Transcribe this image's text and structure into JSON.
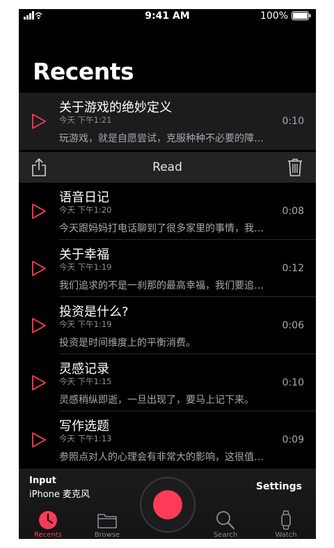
{
  "status_bar": {
    "time": "9:41 AM",
    "battery": "100%"
  },
  "title": "Recents",
  "recordings": [
    {
      "title": "关于游戏的绝妙定义",
      "date": "今天 下午1:21",
      "snippet": "玩游戏，就是自愿尝试，克服种种不必要的障…",
      "duration": "0:10"
    },
    {
      "title": "语音日记",
      "date": "今天 下午1:20",
      "snippet": "今天跟妈妈打电话聊到了很多家里的事情，我…",
      "duration": "0:08"
    },
    {
      "title": "关于幸福",
      "date": "今天 下午1:19",
      "snippet": "我们追求的不是一刹那的最高幸福，我们要追…",
      "duration": "0:12"
    },
    {
      "title": "投资是什么?",
      "date": "今天 下午1:19",
      "snippet": "投资是时间维度上的平衡消费。",
      "duration": "0:06"
    },
    {
      "title": "灵感记录",
      "date": "今天 下午1:15",
      "snippet": "灵感稍纵即逝，一旦出现了，要马上记下来。",
      "duration": "0:10"
    },
    {
      "title": "写作选题",
      "date": "今天 下午1:13",
      "snippet": "参照点对人的心理会有非常大的影响，这很值…",
      "duration": "0:09"
    }
  ],
  "action_row": {
    "read_label": "Read"
  },
  "bottom": {
    "input_label": "Input",
    "input_value": "iPhone 麦克风",
    "settings_label": "Settings",
    "tabs": [
      {
        "label": "Recents",
        "icon": "clock-icon"
      },
      {
        "label": "Browse",
        "icon": "folder-icon"
      },
      {
        "label": "Search",
        "icon": "search-icon"
      },
      {
        "label": "Watch",
        "icon": "watch-icon"
      }
    ]
  },
  "colors": {
    "accent": "#ff3b57",
    "background": "#000000"
  }
}
